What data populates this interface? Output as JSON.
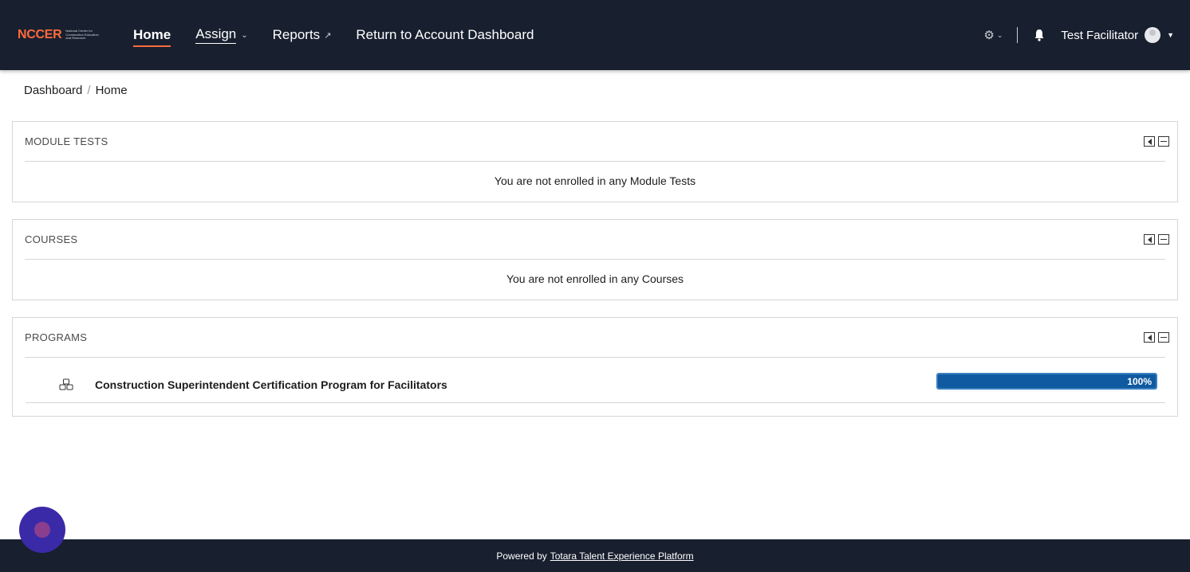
{
  "brand": {
    "logo_text": "NCCER",
    "logo_subtext": "National Center for Construction Education and Research",
    "accent_color": "#ff6a3d",
    "header_bg": "#18202f"
  },
  "nav": {
    "home": "Home",
    "assign": "Assign",
    "reports": "Reports",
    "return_dashboard": "Return to Account Dashboard"
  },
  "user": {
    "name": "Test Facilitator"
  },
  "breadcrumb": {
    "dashboard": "Dashboard",
    "separator": "/",
    "current": "Home"
  },
  "blocks": {
    "module_tests": {
      "title": "MODULE TESTS",
      "message": "You are not enrolled in any Module Tests"
    },
    "courses": {
      "title": "COURSES",
      "message": "You are not enrolled in any Courses"
    },
    "programs": {
      "title": "PROGRAMS",
      "items": [
        {
          "name": "Construction Superintendent Certification Program for Facilitators",
          "progress_label": "100%",
          "progress_percent": 100
        }
      ]
    }
  },
  "footer": {
    "prefix": "Powered by",
    "link": "Totara Talent Experience Platform"
  }
}
